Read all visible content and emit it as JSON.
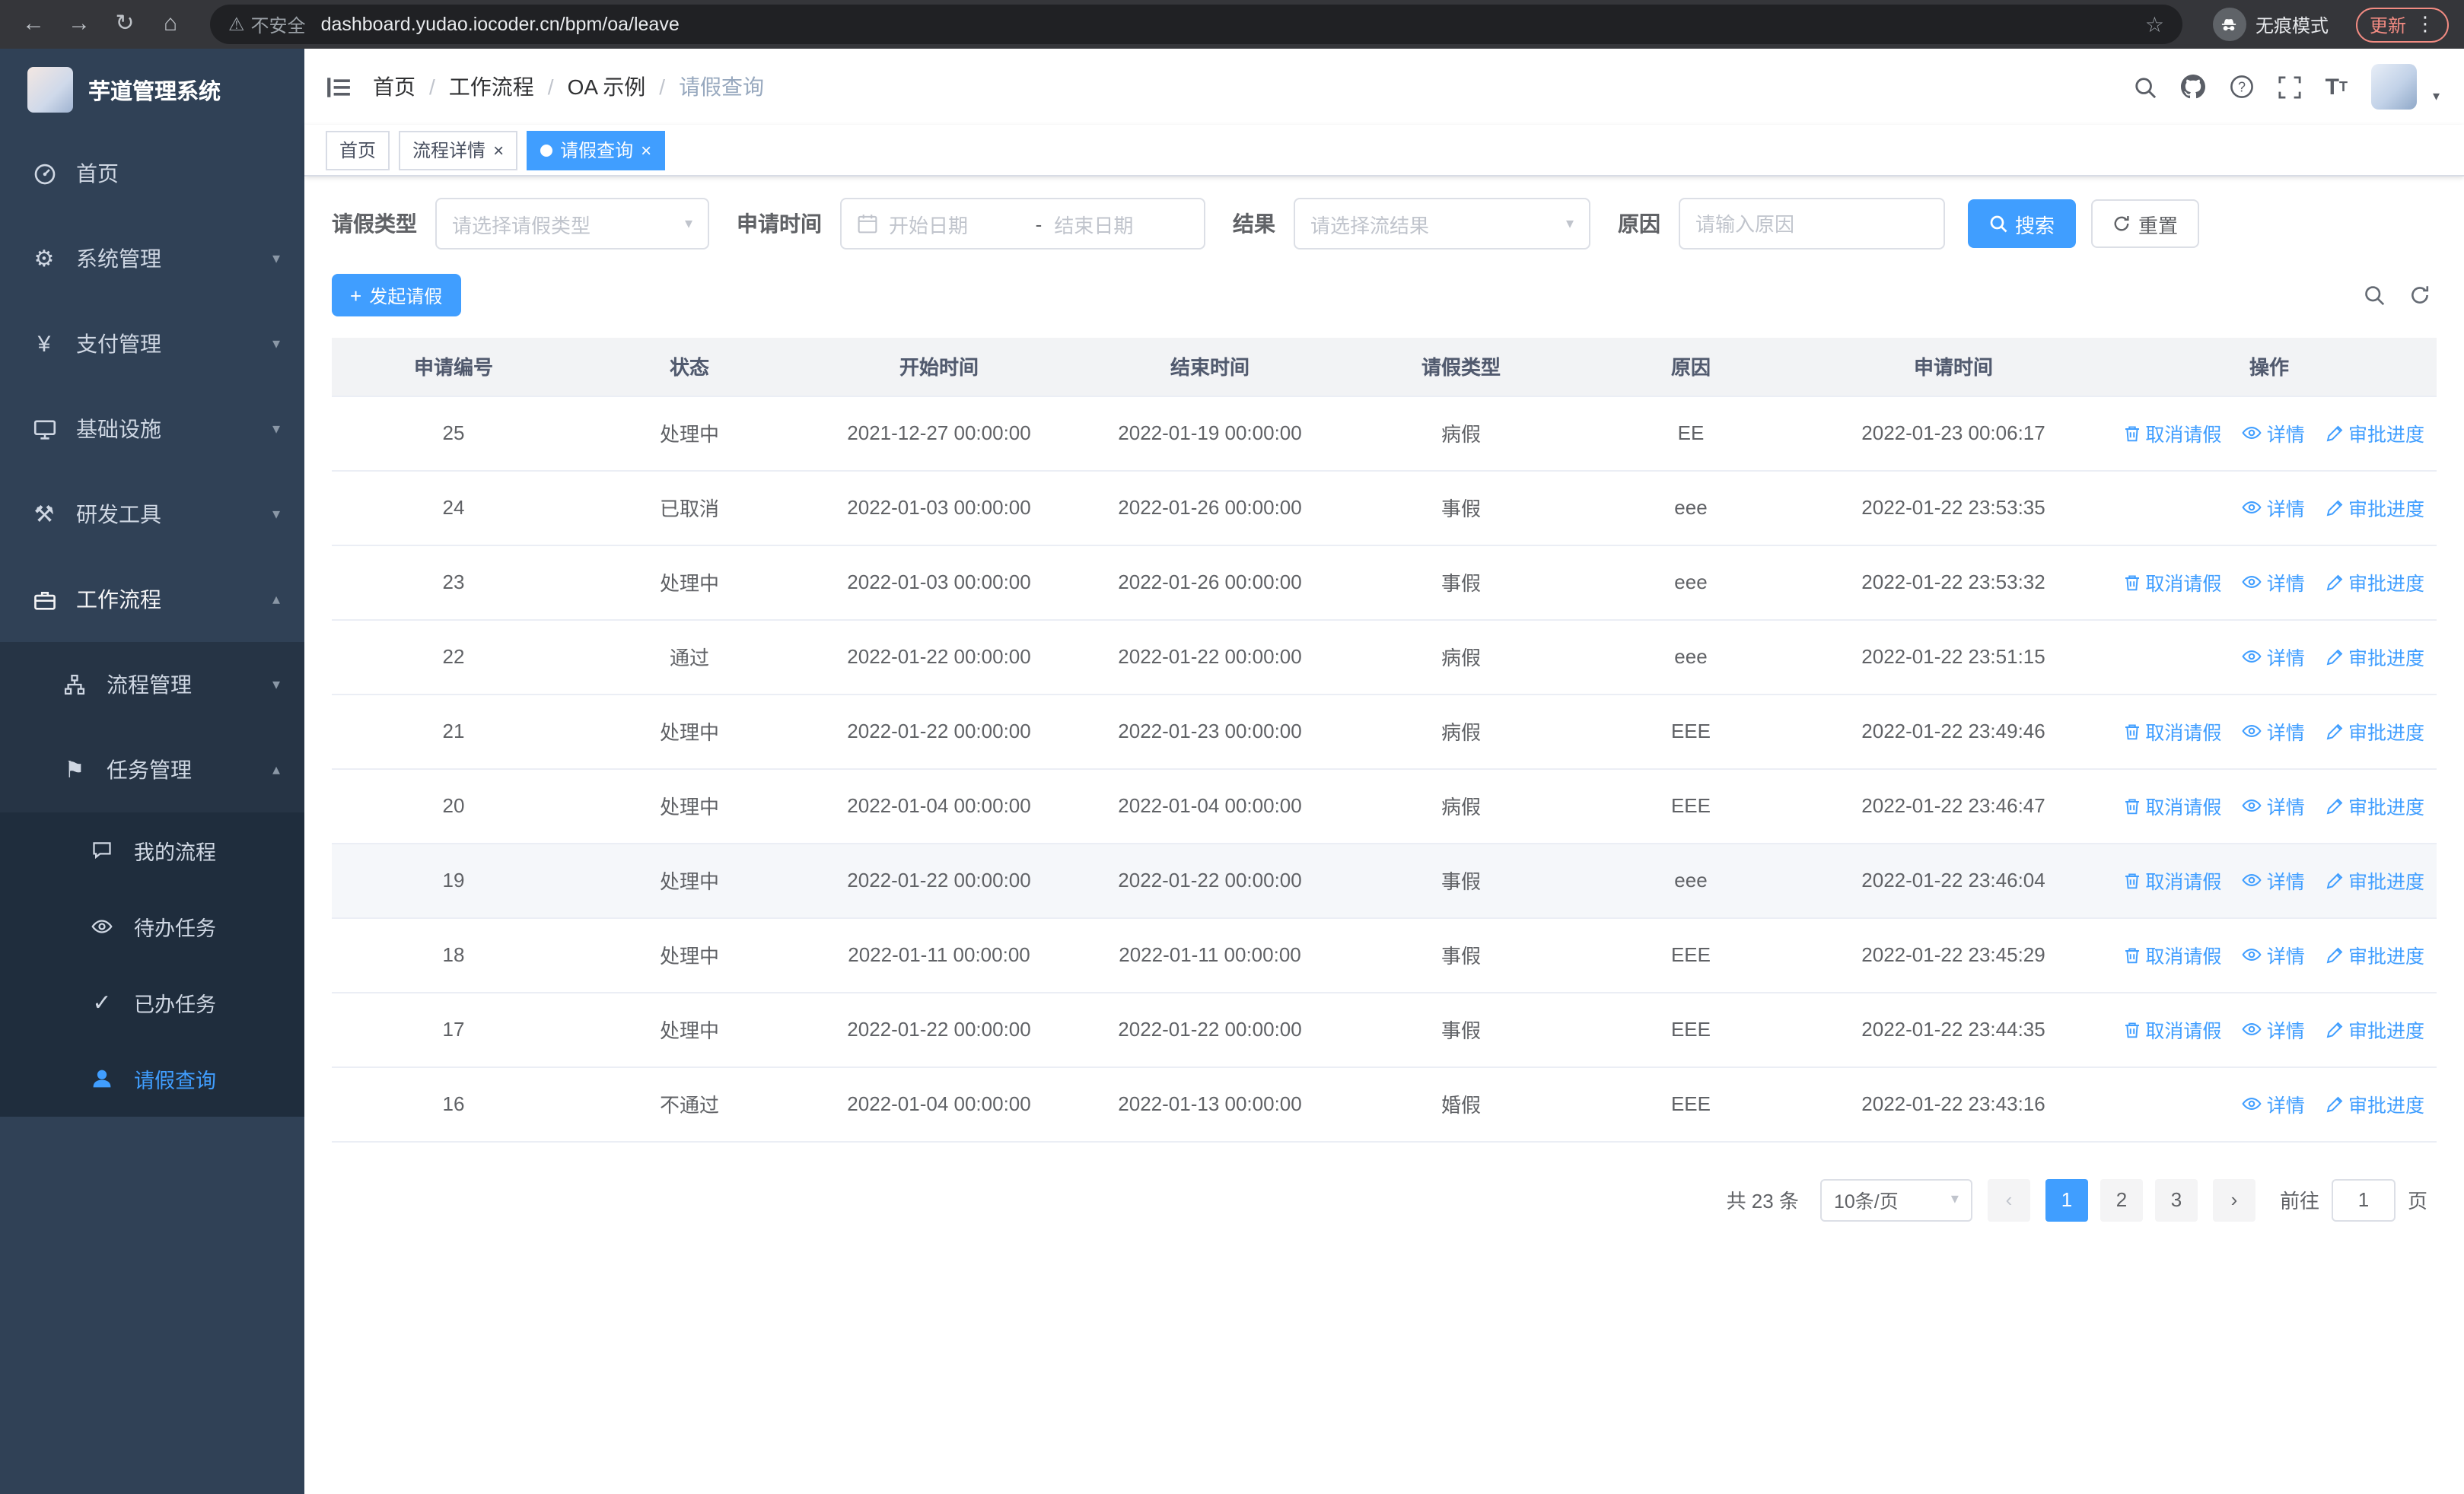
{
  "browser": {
    "warning_label": "不安全",
    "url": "dashboard.yudao.iocoder.cn/bpm/oa/leave",
    "incognito_label": "无痕模式",
    "update_label": "更新"
  },
  "sidebar": {
    "title": "芋道管理系统",
    "menu": [
      {
        "label": "首页"
      },
      {
        "label": "系统管理"
      },
      {
        "label": "支付管理"
      },
      {
        "label": "基础设施"
      },
      {
        "label": "研发工具"
      },
      {
        "label": "工作流程"
      }
    ],
    "submenu": [
      {
        "label": "流程管理"
      },
      {
        "label": "任务管理"
      }
    ],
    "task_children": [
      {
        "label": "我的流程"
      },
      {
        "label": "待办任务"
      },
      {
        "label": "已办任务"
      },
      {
        "label": "请假查询"
      }
    ]
  },
  "breadcrumb": [
    "首页",
    "工作流程",
    "OA 示例",
    "请假查询"
  ],
  "tabs": [
    {
      "label": "首页",
      "closable": false,
      "active": false
    },
    {
      "label": "流程详情",
      "closable": true,
      "active": false
    },
    {
      "label": "请假查询",
      "closable": true,
      "active": true
    }
  ],
  "filters": {
    "leave_type_label": "请假类型",
    "leave_type_placeholder": "请选择请假类型",
    "time_label": "申请时间",
    "start_placeholder": "开始日期",
    "range_separator": "-",
    "end_placeholder": "结束日期",
    "result_label": "结果",
    "result_placeholder": "请选择流结果",
    "reason_label": "原因",
    "reason_placeholder": "请输入原因",
    "search_label": "搜索",
    "reset_label": "重置"
  },
  "toolbar": {
    "create_label": "发起请假"
  },
  "table": {
    "columns": [
      "申请编号",
      "状态",
      "开始时间",
      "结束时间",
      "请假类型",
      "原因",
      "申请时间",
      "操作"
    ],
    "actions": {
      "cancel": "取消请假",
      "detail": "详情",
      "progress": "审批进度"
    },
    "rows": [
      {
        "id": "25",
        "status": "处理中",
        "start": "2021-12-27 00:00:00",
        "end": "2022-01-19 00:00:00",
        "type": "病假",
        "reason": "EE",
        "applied": "2022-01-23 00:06:17",
        "can_cancel": true,
        "highlight": false
      },
      {
        "id": "24",
        "status": "已取消",
        "start": "2022-01-03 00:00:00",
        "end": "2022-01-26 00:00:00",
        "type": "事假",
        "reason": "eee",
        "applied": "2022-01-22 23:53:35",
        "can_cancel": false,
        "highlight": false
      },
      {
        "id": "23",
        "status": "处理中",
        "start": "2022-01-03 00:00:00",
        "end": "2022-01-26 00:00:00",
        "type": "事假",
        "reason": "eee",
        "applied": "2022-01-22 23:53:32",
        "can_cancel": true,
        "highlight": false
      },
      {
        "id": "22",
        "status": "通过",
        "start": "2022-01-22 00:00:00",
        "end": "2022-01-22 00:00:00",
        "type": "病假",
        "reason": "eee",
        "applied": "2022-01-22 23:51:15",
        "can_cancel": false,
        "highlight": false
      },
      {
        "id": "21",
        "status": "处理中",
        "start": "2022-01-22 00:00:00",
        "end": "2022-01-23 00:00:00",
        "type": "病假",
        "reason": "EEE",
        "applied": "2022-01-22 23:49:46",
        "can_cancel": true,
        "highlight": false
      },
      {
        "id": "20",
        "status": "处理中",
        "start": "2022-01-04 00:00:00",
        "end": "2022-01-04 00:00:00",
        "type": "病假",
        "reason": "EEE",
        "applied": "2022-01-22 23:46:47",
        "can_cancel": true,
        "highlight": false
      },
      {
        "id": "19",
        "status": "处理中",
        "start": "2022-01-22 00:00:00",
        "end": "2022-01-22 00:00:00",
        "type": "事假",
        "reason": "eee",
        "applied": "2022-01-22 23:46:04",
        "can_cancel": true,
        "highlight": true
      },
      {
        "id": "18",
        "status": "处理中",
        "start": "2022-01-11 00:00:00",
        "end": "2022-01-11 00:00:00",
        "type": "事假",
        "reason": "EEE",
        "applied": "2022-01-22 23:45:29",
        "can_cancel": true,
        "highlight": false
      },
      {
        "id": "17",
        "status": "处理中",
        "start": "2022-01-22 00:00:00",
        "end": "2022-01-22 00:00:00",
        "type": "事假",
        "reason": "EEE",
        "applied": "2022-01-22 23:44:35",
        "can_cancel": true,
        "highlight": false
      },
      {
        "id": "16",
        "status": "不通过",
        "start": "2022-01-04 00:00:00",
        "end": "2022-01-13 00:00:00",
        "type": "婚假",
        "reason": "EEE",
        "applied": "2022-01-22 23:43:16",
        "can_cancel": false,
        "highlight": false
      }
    ]
  },
  "pagination": {
    "total_label": "共 23 条",
    "page_size_label": "10条/页",
    "pages": [
      {
        "label": "1",
        "active": true
      },
      {
        "label": "2",
        "active": false
      },
      {
        "label": "3",
        "active": false
      }
    ],
    "goto_label": "前往",
    "goto_value": "1",
    "goto_suffix": "页"
  },
  "icons": {
    "back": "←",
    "forward": "→",
    "reload": "↻",
    "home": "⌂",
    "warning": "⚠",
    "star": "☆",
    "menu_dots": "⋮",
    "gear": "⚙",
    "yen": "¥",
    "tools": "⚒",
    "flag": "⚑",
    "check": "✓",
    "chevron_down": "▾",
    "chevron_up": "▴",
    "caret_down": "▾",
    "close": "×",
    "plus": "+",
    "prev": "‹",
    "next": "›",
    "font_big": "T",
    "font_small": "T"
  },
  "colors": {
    "primary": "#409EFF",
    "sidebar": "#304156",
    "chrome": "#35363a"
  }
}
